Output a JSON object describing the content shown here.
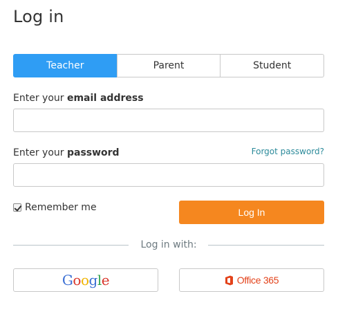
{
  "page": {
    "title": "Log in"
  },
  "tabs": [
    {
      "label": "Teacher",
      "active": true
    },
    {
      "label": "Parent",
      "active": false
    },
    {
      "label": "Student",
      "active": false
    }
  ],
  "email": {
    "label_prefix": "Enter your ",
    "label_bold": "email address",
    "value": "",
    "placeholder": ""
  },
  "password": {
    "label_prefix": "Enter your ",
    "label_bold": "password",
    "forgot_link": "Forgot password?",
    "value": "",
    "placeholder": ""
  },
  "remember": {
    "label": "Remember me",
    "checked": true
  },
  "login_button": {
    "label": "Log In"
  },
  "divider": {
    "text": "Log in with:"
  },
  "sso": {
    "google": {
      "letters": [
        "G",
        "o",
        "o",
        "g",
        "l",
        "e"
      ],
      "colors": [
        "#3b6fd4",
        "#d8352a",
        "#f0b400",
        "#3b6fd4",
        "#2fa44f",
        "#d8352a"
      ]
    },
    "office": {
      "label": "Office 365",
      "color": "#e3421a",
      "icon": "office-logo-icon"
    }
  },
  "colors": {
    "accent_blue": "#2f9df4",
    "login_orange": "#f5871f",
    "link_teal": "#2b8a9a"
  }
}
